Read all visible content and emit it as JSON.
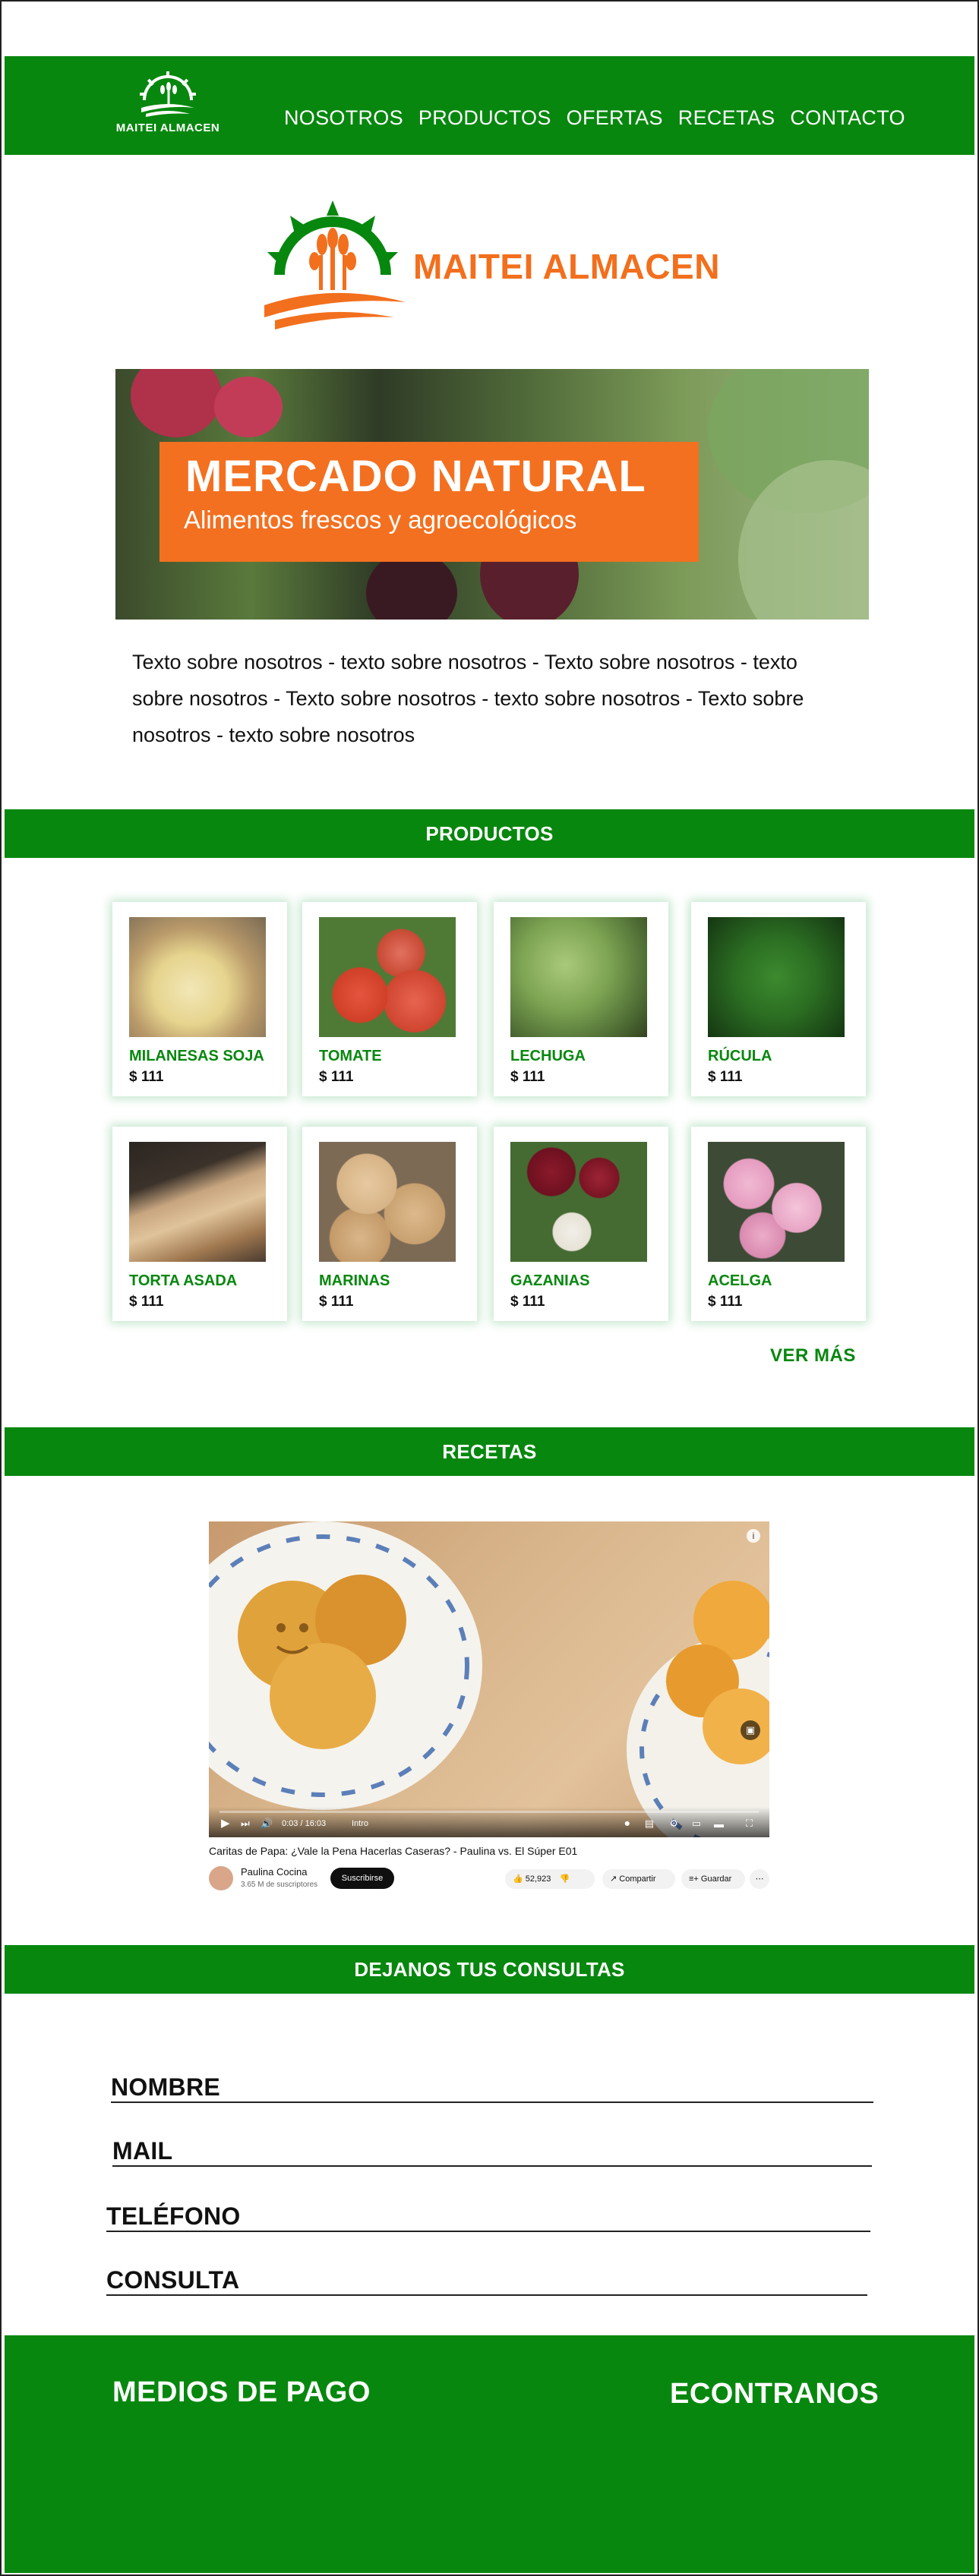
{
  "header": {
    "logo_text": "MAITEI ALMACEN",
    "nav": [
      "NOSOTROS",
      "PRODUCTOS",
      "OFERTAS",
      "RECETAS",
      "CONTACTO"
    ]
  },
  "hero": {
    "brand": "MAITEI ALMACEN",
    "banner_title": "MERCADO  NATURAL",
    "banner_subtitle": "Alimentos frescos y agroecológicos"
  },
  "about": {
    "text": "Texto sobre nosotros - texto sobre nosotros - Texto sobre nosotros - texto sobre nosotros - Texto sobre nosotros - texto sobre nosotros - Texto sobre nosotros - texto sobre nosotros"
  },
  "products": {
    "section_title": "PRODUCTOS",
    "items": [
      {
        "name": "MILANESAS SOJA",
        "price": "$ 111"
      },
      {
        "name": "TOMATE",
        "price": "$ 111"
      },
      {
        "name": "LECHUGA",
        "price": "$ 111"
      },
      {
        "name": "RÚCULA",
        "price": "$ 111"
      },
      {
        "name": "TORTA ASADA",
        "price": "$ 111"
      },
      {
        "name": "MARINAS",
        "price": "$ 111"
      },
      {
        "name": "GAZANIAS",
        "price": "$ 111"
      },
      {
        "name": "ACELGA",
        "price": "$ 111"
      }
    ],
    "more_label": "VER MÁS"
  },
  "recipes": {
    "section_title": "RECETAS",
    "video": {
      "title": "Caritas de Papa: ¿Vale la Pena Hacerlas Caseras? - Paulina vs. El Súper E01",
      "channel": "Paulina Cocina",
      "subscribers": "3.65 M de suscriptores",
      "subscribe_label": "Suscribirse",
      "likes": "52,923",
      "share_label": "Compartir",
      "save_label": "Guardar",
      "time": "0:03 / 16:03",
      "chapter": "Intro"
    }
  },
  "contact": {
    "section_title": "DEJANOS TUS CONSULTAS",
    "fields": [
      "NOMBRE",
      "MAIL",
      "TELÉFONO",
      "CONSULTA"
    ]
  },
  "footer": {
    "payment": "MEDIOS DE PAGO",
    "find_us": "ECONTRANOS"
  },
  "colors": {
    "green": "#07870e",
    "orange": "#f26f1d",
    "banner_orange": "#f37020"
  }
}
